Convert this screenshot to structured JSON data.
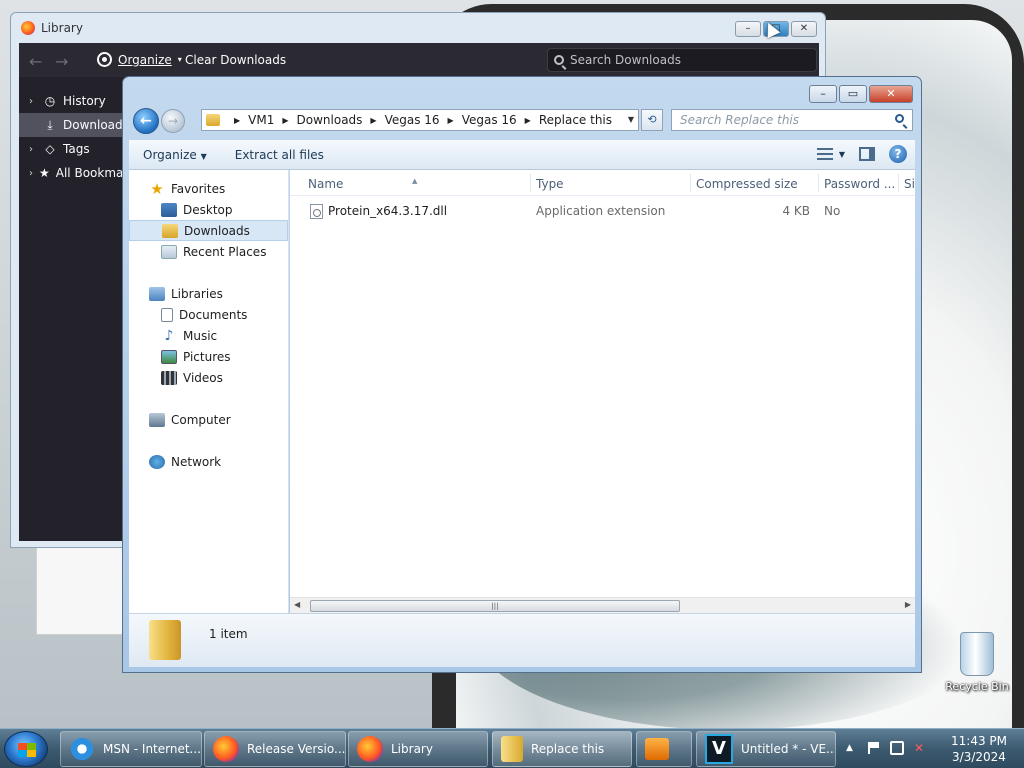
{
  "desktop": {
    "recycle_bin_label": "Recycle Bin"
  },
  "library": {
    "title": "Library",
    "toolbar": {
      "organize": "Organize",
      "clear_downloads": "Clear Downloads",
      "search_placeholder": "Search Downloads"
    },
    "sidebar": [
      {
        "label": "History",
        "icon": "clock-icon",
        "selected": false
      },
      {
        "label": "Downloads",
        "icon": "download-icon",
        "selected": true
      },
      {
        "label": "Tags",
        "icon": "tag-icon",
        "selected": false
      },
      {
        "label": "All Bookmarks",
        "icon": "star-icon",
        "selected": false
      }
    ]
  },
  "explorer": {
    "breadcrumb": [
      "VM1",
      "Downloads",
      "Vegas 16",
      "Vegas 16",
      "Replace this"
    ],
    "search_placeholder": "Search Replace this",
    "commands": {
      "organize": "Organize",
      "extract": "Extract all files"
    },
    "nav": {
      "favorites": "Favorites",
      "desktop": "Desktop",
      "downloads": "Downloads",
      "recent": "Recent Places",
      "libraries": "Libraries",
      "documents": "Documents",
      "music": "Music",
      "pictures": "Pictures",
      "videos": "Videos",
      "computer": "Computer",
      "network": "Network"
    },
    "columns": {
      "name": "Name",
      "type": "Type",
      "compressed": "Compressed size",
      "password": "Password ...",
      "size": "Si"
    },
    "files": [
      {
        "name": "Protein_x64.3.17.dll",
        "type": "Application extension",
        "compressed": "4 KB",
        "password": "No"
      }
    ],
    "status": "1 item"
  },
  "taskbar": {
    "tasks": [
      {
        "label": "MSN - Internet...",
        "icon": "ie-icon"
      },
      {
        "label": "Release Versio...",
        "icon": "firefox-icon"
      },
      {
        "label": "Library",
        "icon": "firefox-icon"
      },
      {
        "label": "Replace this",
        "icon": "folder-icon"
      },
      {
        "label": "",
        "icon": "media-player-icon"
      },
      {
        "label": "Untitled * - VE...",
        "icon": "vegas-icon"
      }
    ],
    "clock": {
      "time": "11:43 PM",
      "date": "3/3/2024"
    }
  }
}
